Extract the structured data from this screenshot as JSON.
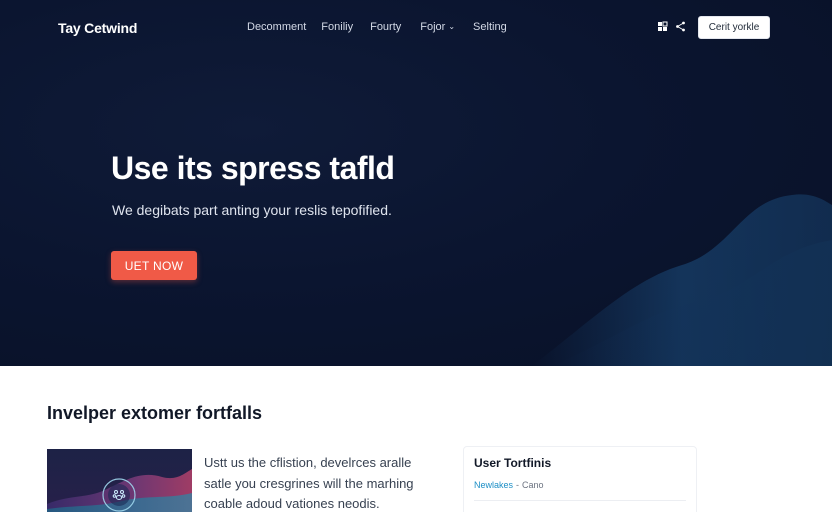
{
  "nav": {
    "brand": "Tay Cetwind",
    "items": [
      {
        "label": "Decomment"
      },
      {
        "label": "Foniliy"
      },
      {
        "label": "Fourty"
      },
      {
        "label": "Fojor",
        "has_dropdown": true
      },
      {
        "label": "Selting"
      }
    ],
    "icons": [
      "grid-icon",
      "share-icon"
    ],
    "cta_label": "Cerit yorkle"
  },
  "hero": {
    "title": "Use its spress tafld",
    "subtitle": "We degibats part anting your reslis tepofified.",
    "button_label": "UET NOW"
  },
  "section": {
    "title": "Invelper extomer fortfalls",
    "description_lines": [
      "Ustt us the cflistion, develrces aralle",
      "satle you cresgrines will the marhing",
      "coable adoud vationes neodis."
    ],
    "card": {
      "title": "User Tortfinis",
      "link": "Newlakes",
      "separator": "-",
      "extra": "Cano"
    }
  },
  "colors": {
    "hero_bg": "#0b1530",
    "accent": "#f05a47",
    "link": "#1d8fc6"
  }
}
